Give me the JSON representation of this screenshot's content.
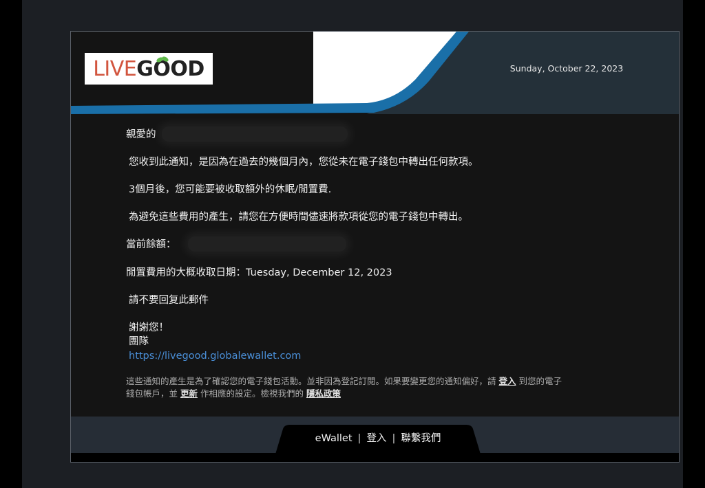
{
  "header": {
    "logo": {
      "live": "LIVE",
      "good": "GOOD"
    },
    "date": "Sunday, October 22, 2023"
  },
  "body": {
    "greeting": "親愛的",
    "p1": "您收到此通知，是因為在過去的幾個月內，您從未在電子錢包中轉出任何款項。",
    "p2": "3個月後，您可能要被收取額外的休眠/閒置費.",
    "p3": "為避免這些費用的產生，請您在方便時間儘速將款項從您的電子錢包中轉出。",
    "balance_label": "當前餘額：",
    "fee_date": "閒置費用的大概收取日期：Tuesday, December 12, 2023",
    "no_reply": "請不要回复此郵件",
    "thanks": "謝謝您！",
    "team": "團隊",
    "link": "https://livegood.globalewallet.com"
  },
  "note": {
    "part1": "這些通知的產生是為了確認您的電子錢包活動。並非因為登記訂閱。如果要變更您的通知偏好，請 ",
    "login": "登入",
    "part2": " 到您的電子",
    "part3": "錢包帳戶，並 ",
    "update": "更新",
    "part4": " 作相應的設定。檢視我們的 ",
    "privacy": "隱私政策"
  },
  "footer": {
    "ewallet": "eWallet",
    "sep": "|",
    "login": "登入",
    "contact": "聯繫我們"
  },
  "colors": {
    "accent_blue": "#1a6fa8",
    "header_dark": "#243039",
    "link": "#4a8fd8",
    "logo_red": "#d2553e",
    "logo_green": "#5fb94a"
  }
}
